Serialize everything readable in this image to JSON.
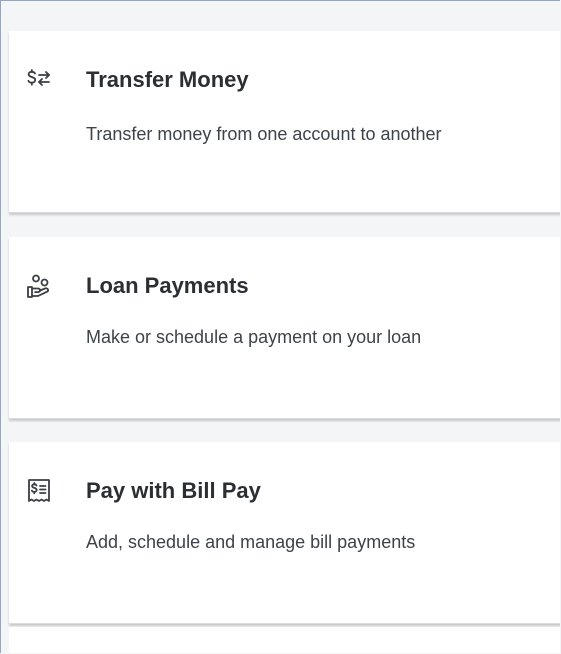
{
  "actions": [
    {
      "title": "Transfer Money",
      "description": "Transfer money from one account to another",
      "icon": "transfer-money-icon"
    },
    {
      "title": "Loan Payments",
      "description": "Make or schedule a payment on your loan",
      "icon": "loan-payment-icon"
    },
    {
      "title": "Pay with Bill Pay",
      "description": "Add, schedule and manage bill payments",
      "icon": "bill-pay-icon"
    }
  ],
  "colors": {
    "background": "#f4f5f7",
    "card": "#ffffff",
    "text_primary": "#2b2f33",
    "text_secondary": "#3e4349",
    "border": "#9ba6b5"
  }
}
